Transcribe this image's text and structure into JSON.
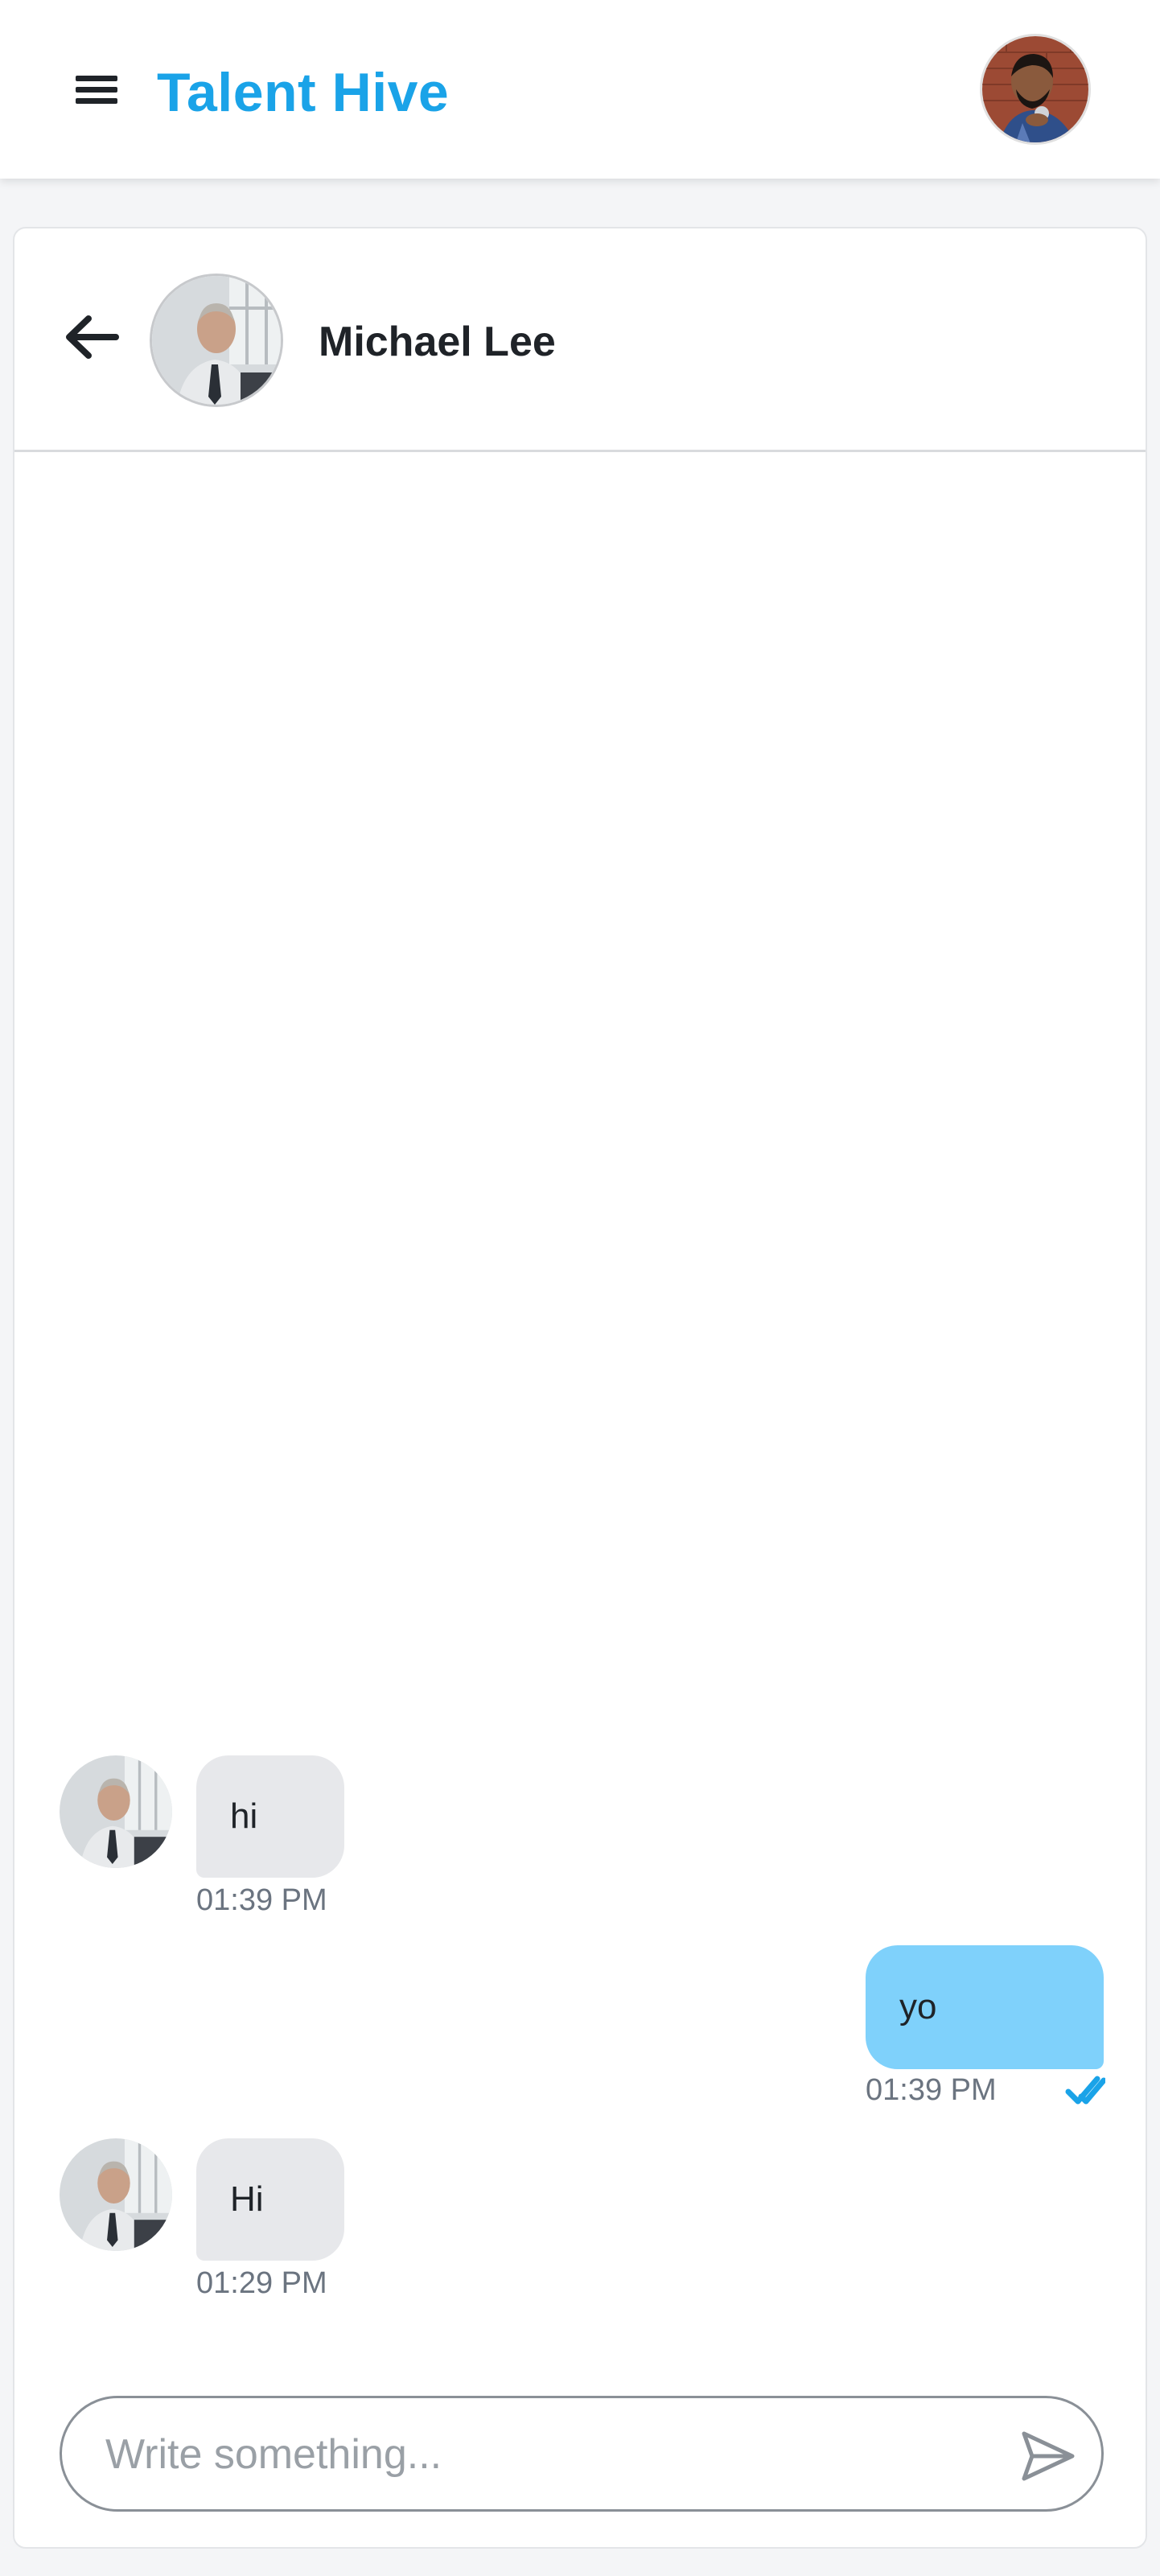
{
  "app": {
    "brand": "Talent Hive",
    "menu_icon": "hamburger-menu-icon",
    "user_avatar_icon": "user-avatar"
  },
  "chat": {
    "contact_name": "Michael Lee",
    "back_icon": "arrow-left-icon",
    "messages": [
      {
        "direction": "incoming",
        "text": "hi",
        "time": "01:39 PM"
      },
      {
        "direction": "outgoing",
        "text": "yo",
        "time": "01:39 PM",
        "status_icon": "double-check-icon"
      },
      {
        "direction": "incoming",
        "text": "Hi",
        "time": "01:29 PM"
      }
    ],
    "composer": {
      "placeholder": "Write something...",
      "value": "",
      "send_icon": "send-icon"
    }
  },
  "colors": {
    "brand": "#1aa3e8",
    "outgoing_bubble": "#7fd1fb",
    "incoming_bubble": "#e7e8eb",
    "read_check": "#1aa3e8"
  }
}
